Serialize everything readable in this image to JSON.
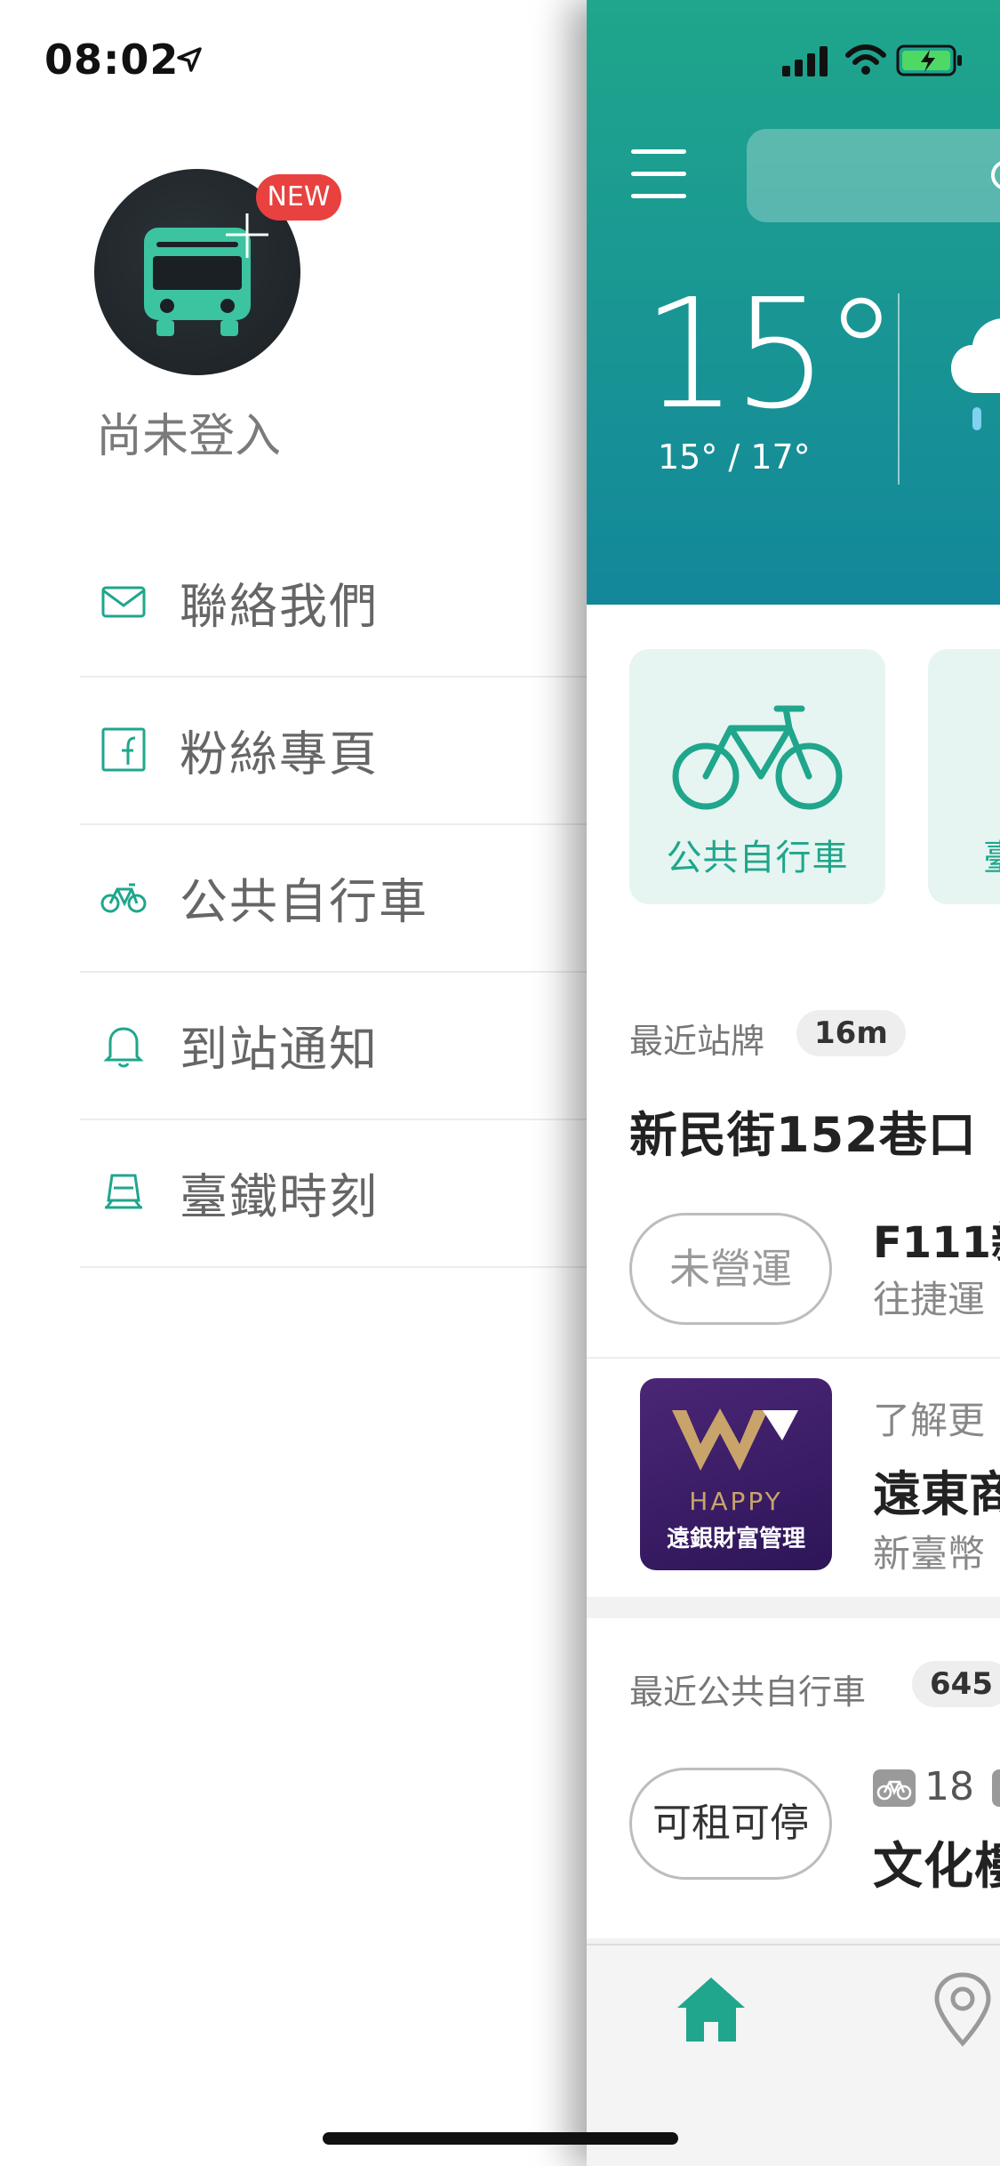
{
  "status_bar": {
    "time": "08:02"
  },
  "drawer": {
    "new_badge": "NEW",
    "login_status": "尚未登入",
    "menu": [
      {
        "label": "聯絡我們",
        "icon": "mail-icon"
      },
      {
        "label": "粉絲專頁",
        "icon": "facebook-icon"
      },
      {
        "label": "公共自行車",
        "icon": "bicycle-icon"
      },
      {
        "label": "到站通知",
        "icon": "bell-icon"
      },
      {
        "label": "臺鐵時刻",
        "icon": "train-icon"
      }
    ]
  },
  "weather": {
    "temp": "15°",
    "range": "15° / 17°",
    "icon": "cloud-rain-icon"
  },
  "features": [
    {
      "label": "公共自行車",
      "icon": "bicycle-icon"
    },
    {
      "label": "臺",
      "icon": "train-icon"
    }
  ],
  "nearest_stop": {
    "section": "最近站牌",
    "distance": "16m",
    "name": "新民街152巷口",
    "status": "未營運",
    "route": "F111新",
    "direction": "往捷運"
  },
  "ad": {
    "logo_text": "HAPPY",
    "logo_sub": "遠銀財富管理",
    "line1": "了解更",
    "title": "遠東商",
    "line3": "新臺幣"
  },
  "nearest_bike": {
    "section": "最近公共自行車",
    "distance": "645",
    "status": "可租可停",
    "bikes": "18",
    "station": "文化樓"
  },
  "tabs": [
    {
      "icon": "home-icon",
      "active": true
    },
    {
      "icon": "location-pin-icon",
      "active": false
    }
  ],
  "colors": {
    "accent": "#1fa68c",
    "badge": "#e8413f",
    "ad_purple": "#3c1f68"
  }
}
